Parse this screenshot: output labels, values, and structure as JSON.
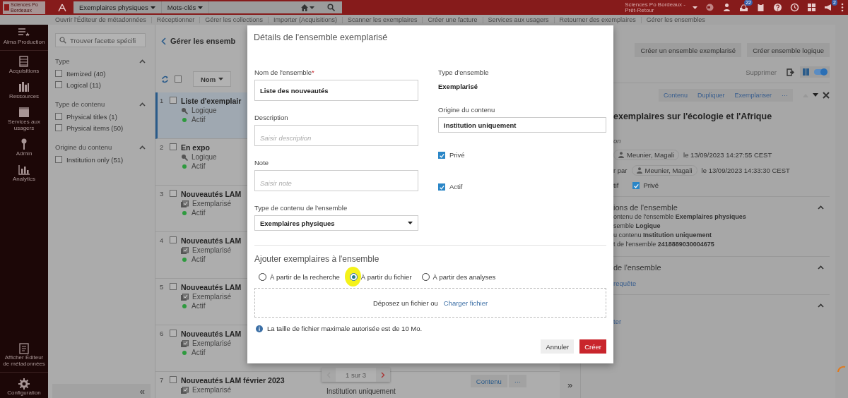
{
  "top_bar": {
    "logo": "Sciences Po Bordeaux",
    "search_scope": "Exemplaires physiques",
    "search_field": "Mots-clés",
    "institution": [
      "Sciences Po Bordeaux -",
      "Prêt-Retour"
    ],
    "task_badge": "22",
    "notification_badge": "2"
  },
  "nav_links": [
    "Ouvrir l'Éditeur de métadonnées",
    "Réceptionner",
    "Gérer les collections",
    "Importer (Acquisitions)",
    "Scanner les exemplaires",
    "Créer une facture",
    "Services aux usagers",
    "Retourner des exemplaires",
    "Gérer les ensembles"
  ],
  "sidebar": {
    "items": [
      {
        "label": "Alma Production"
      },
      {
        "label": "Acquisitions"
      },
      {
        "label": "Ressources"
      },
      {
        "label": "Services aux usagers"
      },
      {
        "label": "Admin"
      },
      {
        "label": "Analytics"
      }
    ],
    "bottom_items": [
      {
        "label": "Afficher Éditeur de métadonnées"
      },
      {
        "label": "Configuration"
      }
    ]
  },
  "facets": {
    "search_placeholder": "Trouver facette spécifi",
    "groups": [
      {
        "title": "Type",
        "expanded": true,
        "options": [
          {
            "label": "Itemized (40)",
            "checked": false
          },
          {
            "label": "Logical (11)",
            "checked": false
          }
        ]
      },
      {
        "title": "Type de contenu",
        "expanded": true,
        "options": [
          {
            "label": "Physical titles (1)",
            "checked": false
          },
          {
            "label": "Physical items (50)",
            "checked": false
          }
        ]
      },
      {
        "title": "Origine du contenu",
        "expanded": true,
        "options": [
          {
            "label": "Institution only (51)",
            "checked": false
          }
        ]
      }
    ],
    "collapse": "«"
  },
  "list": {
    "title": "Gérer les ensemb",
    "select_all_checked": false,
    "sort": "Nom",
    "rows": [
      {
        "number": "1",
        "title": "Liste d'exemplair",
        "kind": "logical",
        "type": "Logique",
        "status": "Actif",
        "checked": false,
        "selected": true
      },
      {
        "number": "2",
        "title": "En expo",
        "kind": "logical",
        "type": "Logique",
        "status": "Actif",
        "checked": false,
        "selected": false
      },
      {
        "number": "3",
        "title": "Nouveautés LAM",
        "kind": "itemized",
        "type": "Exemplarisé",
        "status": "Actif",
        "checked": false,
        "selected": false
      },
      {
        "number": "4",
        "title": "Nouveautés LAM",
        "kind": "itemized",
        "type": "Exemplarisé",
        "status": "Actif",
        "checked": false,
        "selected": false
      },
      {
        "number": "5",
        "title": "Nouveautés LAM",
        "kind": "itemized",
        "type": "Exemplarisé",
        "status": "Actif",
        "checked": false,
        "selected": false
      },
      {
        "number": "6",
        "title": "Nouveautés LAM",
        "kind": "itemized",
        "type": "Exemplarisé",
        "status": "Actif",
        "checked": false,
        "selected": false
      },
      {
        "number": "7",
        "title": "Nouveautés LAM février 2023",
        "kind": "itemized",
        "type": "Exemplarisé",
        "origin": "Institution uniquement",
        "actions": [
          "Contenu",
          "···"
        ],
        "checked": false,
        "selected": false
      }
    ],
    "pager": "1 sur 3",
    "expand": "»"
  },
  "right_panel": {
    "create_buttons": [
      "Créer un ensemble exemplarisé",
      "Créer ensemble logique"
    ],
    "delete": {
      "label": "Supprimer",
      "disabled": true
    },
    "toggle_on": true,
    "detail": {
      "actions": [
        "Contenu",
        "Dupliquer",
        "Exemplariser",
        "···"
      ],
      "title": "exemplaires sur l'écologie et l'Afrique",
      "fragment": "on",
      "history": [
        {
          "user": "Meunier, Magali",
          "date": "le 13/09/2023 14:27:55 CEST"
        },
        {
          "prefix": "r par",
          "user": "Meunier, Magali",
          "date": "le 13/09/2023 14:33:30 CEST"
        }
      ],
      "flags": [
        {
          "kind": "text",
          "label": "tif"
        },
        {
          "kind": "checkbox",
          "label": "Privé",
          "checked": true
        }
      ],
      "sections": [
        {
          "title": "ions de l'ensemble",
          "expanded": true,
          "lines": [
            "ontenu de l'ensemble **Exemplaires physiques**",
            "semble **Logique**",
            "u contenu **Institution uniquement**",
            "t de l'ensemble **2418889030004675**"
          ]
        },
        {
          "title": "de l'ensemble",
          "expanded": true,
          "link": "requête"
        },
        {
          "expanded": true,
          "link": "ter"
        }
      ]
    }
  },
  "modal": {
    "title": "Détails de l'ensemble exemplarisé",
    "name": {
      "label": "Nom de l'ensemble",
      "required_mark": "*",
      "value": "Liste des nouveautés"
    },
    "description": {
      "label": "Description",
      "placeholder": "Saisir description"
    },
    "note": {
      "label": "Note",
      "placeholder": "Saisir note"
    },
    "content_type": {
      "label": "Type de contenu de l'ensemble",
      "value": "Exemplaires physiques"
    },
    "set_type": {
      "label": "Type d'ensemble",
      "value": "Exemplarisé"
    },
    "origin": {
      "label": "Origine du contenu",
      "value": "Institution uniquement"
    },
    "checkboxes": [
      {
        "label": "Privé",
        "checked": true
      },
      {
        "label": "Actif",
        "checked": true
      }
    ],
    "add_title": "Ajouter exemplaires à l'ensemble",
    "sources": [
      {
        "label": "À partir de la recherche",
        "selected": false
      },
      {
        "label": "À partir du fichier",
        "selected": true
      },
      {
        "label": "À partir des analyses",
        "selected": false
      }
    ],
    "dropzone": {
      "text": "Déposez un fichier ou",
      "link": "Charger fichier"
    },
    "info": "La taille de fichier maximale autorisée est de 10 Mo.",
    "cancel": "Annuler",
    "create": "Créer"
  }
}
